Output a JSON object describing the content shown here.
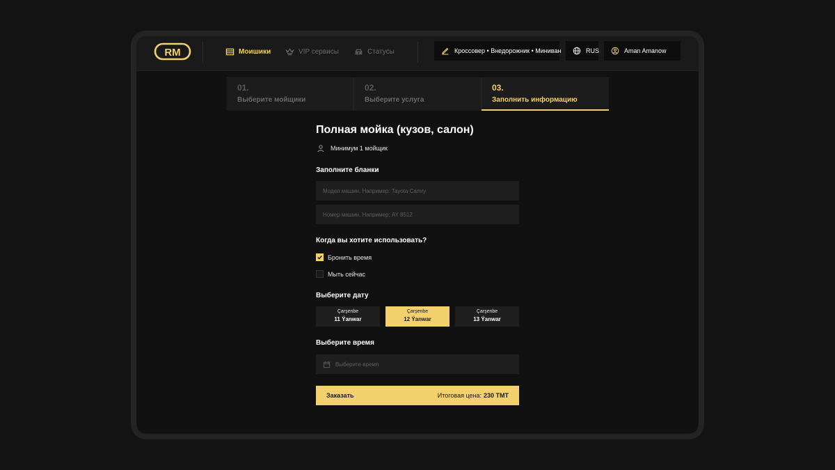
{
  "header": {
    "logo_text": "RM",
    "nav": [
      {
        "label": "Моишики",
        "icon": "car-wash-icon",
        "active": true
      },
      {
        "label": "VIP сервисы",
        "icon": "crown-icon",
        "active": false
      },
      {
        "label": "Статусы",
        "icon": "car-icon",
        "active": false
      }
    ],
    "car_types": "Кроссовер • Внедорожник • Миниван",
    "car_types_icon": "edit-icon",
    "language": "RUS",
    "language_icon": "globe-icon",
    "user_name": "Aman Amanow",
    "user_icon": "user-icon"
  },
  "steps": [
    {
      "num": "01.",
      "label": "Выберите мойщики",
      "active": false
    },
    {
      "num": "02.",
      "label": "Выберите услуга",
      "active": false
    },
    {
      "num": "03.",
      "label": "Заполнить информацию",
      "active": true
    }
  ],
  "form": {
    "title": "Полная мойка (кузов, салон)",
    "min_workers": "Минимум 1 мойщик",
    "fill_title": "Заполните бланки",
    "car_model_placeholder": "Модел машин. Например: Tayota Camry",
    "car_number_placeholder": "Номер машин. Например: AY 8512",
    "when_title": "Когда вы хотите использовать?",
    "options": [
      {
        "label": "Бронить время",
        "checked": true
      },
      {
        "label": "Мыть сейчас",
        "checked": false
      }
    ],
    "date_title": "Выберите дату",
    "dates": [
      {
        "day": "Çarşenbe",
        "date": "11 Ýanwar",
        "active": false
      },
      {
        "day": "Çarşenbe",
        "date": "12 Ýanwar",
        "active": true
      },
      {
        "day": "Çarşenbe",
        "date": "13 Ýanwar",
        "active": false
      }
    ],
    "time_title": "Выберите время",
    "time_placeholder": "Выберите время",
    "time_icon": "calendar-icon",
    "order_label": "Заказать",
    "total_label": "Итоговая цена:",
    "total_value": "230 TMT"
  },
  "colors": {
    "accent": "#f2d06b",
    "background": "#111111",
    "field": "#1f1f1f"
  }
}
